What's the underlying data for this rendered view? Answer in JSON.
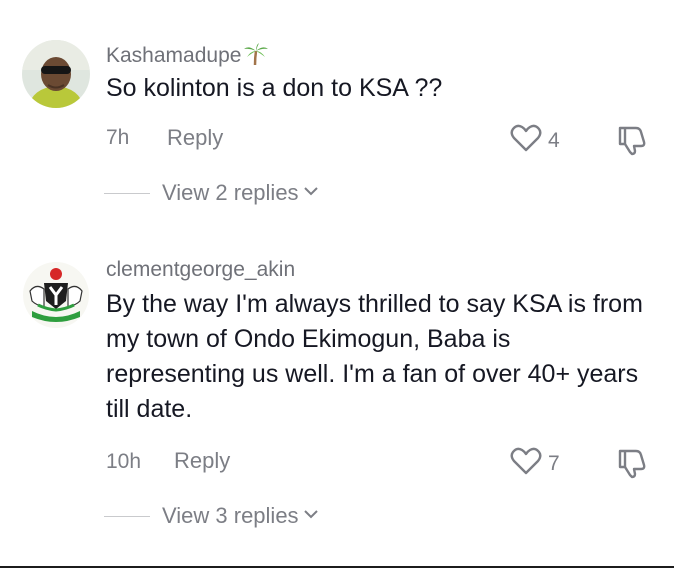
{
  "comments": [
    {
      "username": "Kashamadupe",
      "username_emoji": "palm-tree",
      "text": "So kolinton is a don to KSA ??",
      "time": "7h",
      "reply_label": "Reply",
      "likes": "4",
      "view_replies_label": "View 2 replies"
    },
    {
      "username": "clementgeorge_akin",
      "text": "By the way I'm always thrilled to say KSA is from my town of Ondo Ekimogun, Baba is representing us well. I'm a fan of over 40+ years till date.",
      "time": "10h",
      "reply_label": "Reply",
      "likes": "7",
      "view_replies_label": "View 3 replies"
    }
  ],
  "colors": {
    "username": "#6f7178",
    "text": "#161823",
    "muted": "#7c7e85"
  }
}
